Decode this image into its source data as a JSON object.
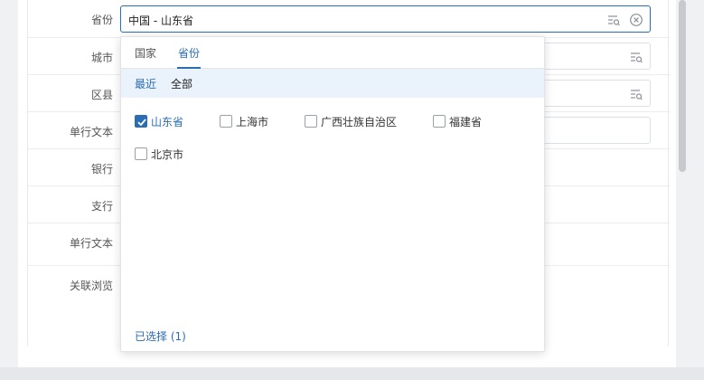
{
  "form": {
    "province": {
      "label": "省份",
      "value": "中国 - 山东省"
    },
    "city": {
      "label": "城市"
    },
    "county": {
      "label": "区县"
    },
    "single_text_1": {
      "label": "单行文本"
    },
    "bank": {
      "label": "银行"
    },
    "branch": {
      "label": "支行"
    },
    "single_text_2": {
      "label": "单行文本"
    },
    "related_browse": {
      "label": "关联浏览"
    }
  },
  "popup": {
    "tabs": [
      {
        "label": "国家"
      },
      {
        "label": "省份",
        "active": true
      }
    ],
    "subtabs": [
      {
        "label": "最近",
        "active": true
      },
      {
        "label": "全部"
      }
    ],
    "options": [
      {
        "label": "山东省",
        "checked": true
      },
      {
        "label": "上海市",
        "checked": false
      },
      {
        "label": "广西壮族自治区",
        "checked": false
      },
      {
        "label": "福建省",
        "checked": false
      },
      {
        "label": "北京市",
        "checked": false
      }
    ],
    "selected_label": "已选择 (1)"
  },
  "icons": {
    "browse": "list-search-icon",
    "clear": "clear-circle-icon",
    "check": "check-icon"
  },
  "colors": {
    "accent": "#2a6db3",
    "subtab_bg": "#eaf2fb"
  }
}
